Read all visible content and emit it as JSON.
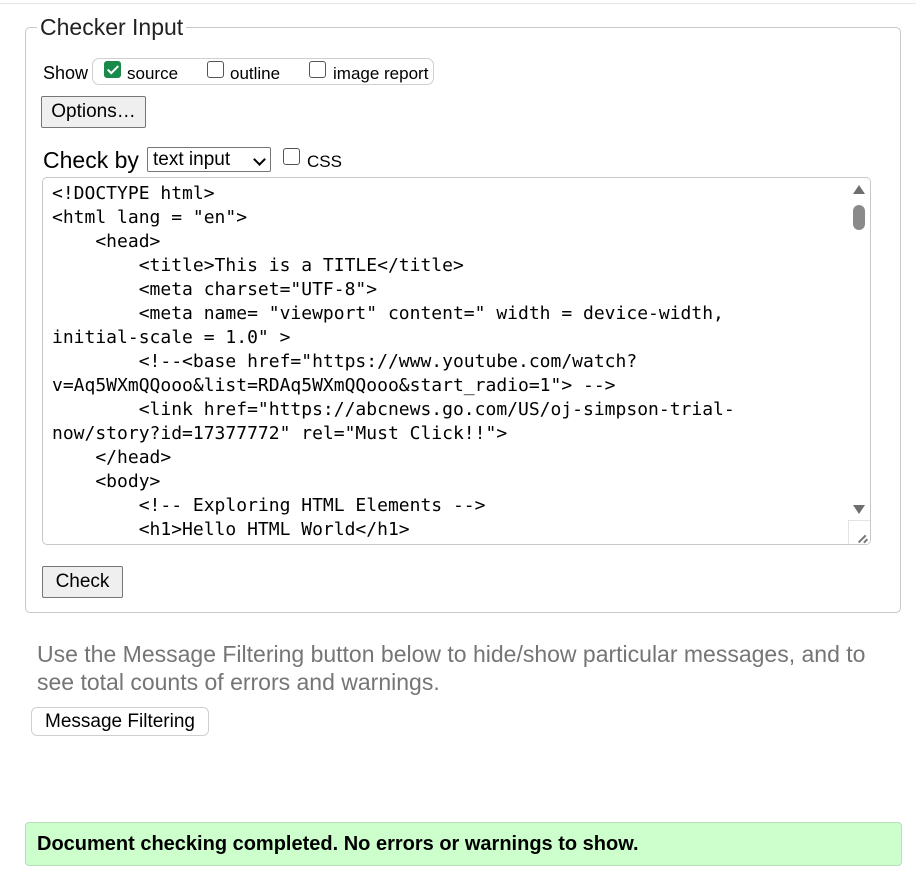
{
  "checker": {
    "legend": "Checker Input",
    "show_label": "Show",
    "show_options": [
      {
        "label": "source",
        "checked": true
      },
      {
        "label": "outline",
        "checked": false
      },
      {
        "label": "image report",
        "checked": false
      }
    ],
    "options_button": "Options…",
    "check_by_label": "Check by",
    "check_by_selected": "text input",
    "css_label": "CSS",
    "css_checked": false,
    "source_text": "<!DOCTYPE html>\n<html lang = \"en\">\n    <head>\n        <title>This is a TITLE</title>\n        <meta charset=\"UTF-8\">\n        <meta name= \"viewport\" content=\" width = device-width,\ninitial-scale = 1.0\" >\n        <!--<base href=\"https://www.youtube.com/watch?\nv=Aq5WXmQQooo&list=RDAq5WXmQQooo&start_radio=1\"> -->\n        <link href=\"https://abcnews.go.com/US/oj-simpson-trial-\nnow/story?id=17377772\" rel=\"Must Click!!\">\n    </head>\n    <body>\n        <!-- Exploring HTML Elements -->\n        <h1>Hello HTML World</h1>",
    "check_button": "Check"
  },
  "filter_note": "Use the Message Filtering button below to hide/show particular messages, and to see total counts of errors and warnings.",
  "filter_button": "Message Filtering",
  "status_message": "Document checking completed. No errors or warnings to show.",
  "colors": {
    "success_bg": "#ccffcc",
    "checkbox_checked": "#198a4a",
    "note_text": "#757575"
  }
}
